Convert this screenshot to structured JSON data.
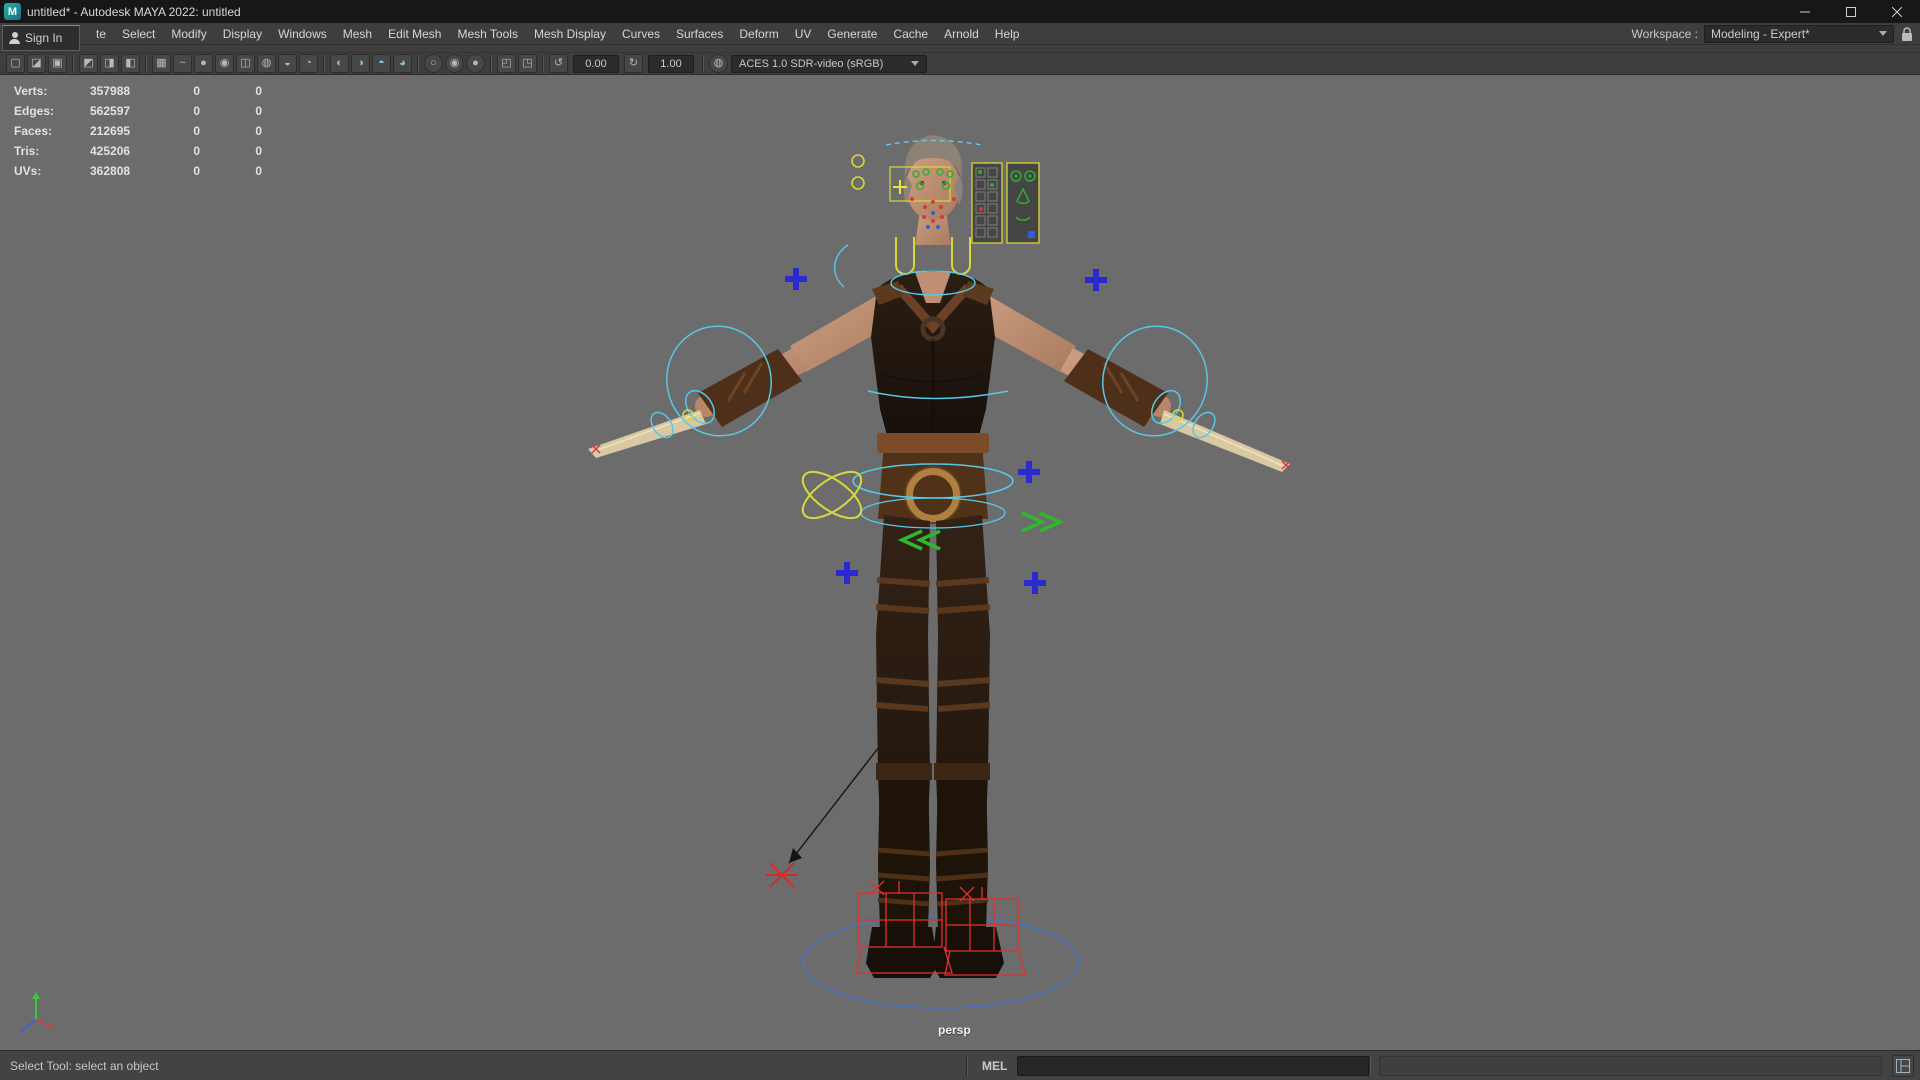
{
  "window": {
    "title": "untitled* - Autodesk MAYA 2022: untitled"
  },
  "signin": {
    "label": "Sign In"
  },
  "menubar": {
    "items": [
      "te",
      "Select",
      "Modify",
      "Display",
      "Windows",
      "Mesh",
      "Edit Mesh",
      "Mesh Tools",
      "Mesh Display",
      "Curves",
      "Surfaces",
      "Deform",
      "UV",
      "Generate",
      "Cache",
      "Arnold",
      "Help"
    ],
    "workspace": {
      "label": "Workspace :",
      "value": "Modeling - Expert*"
    }
  },
  "toolbar": {
    "field_1": "0.00",
    "field_2": "1.00",
    "color_space": "ACES 1.0 SDR-video (sRGB)"
  },
  "hud": {
    "rows": [
      {
        "label": "Verts:",
        "value": "357988",
        "col1": "0",
        "col2": "0"
      },
      {
        "label": "Edges:",
        "value": "562597",
        "col1": "0",
        "col2": "0"
      },
      {
        "label": "Faces:",
        "value": "212695",
        "col1": "0",
        "col2": "0"
      },
      {
        "label": "Tris:",
        "value": "425206",
        "col1": "0",
        "col2": "0"
      },
      {
        "label": "UVs:",
        "value": "362808",
        "col1": "0",
        "col2": "0"
      }
    ]
  },
  "viewport": {
    "camera_label": "persp"
  },
  "statusbar": {
    "help_text": "Select Tool: select an object",
    "mel_label": "MEL"
  },
  "colors": {
    "viewport_bg": "#6c6c6c",
    "chrome_bg": "#3e3e3e",
    "rig_yellow": "#d8d838",
    "rig_cyan": "#58c8e8",
    "rig_blue": "#2a2ad0",
    "rig_red": "#e23030",
    "rig_green": "#2db82d",
    "ground_blue": "#4a72c4"
  }
}
